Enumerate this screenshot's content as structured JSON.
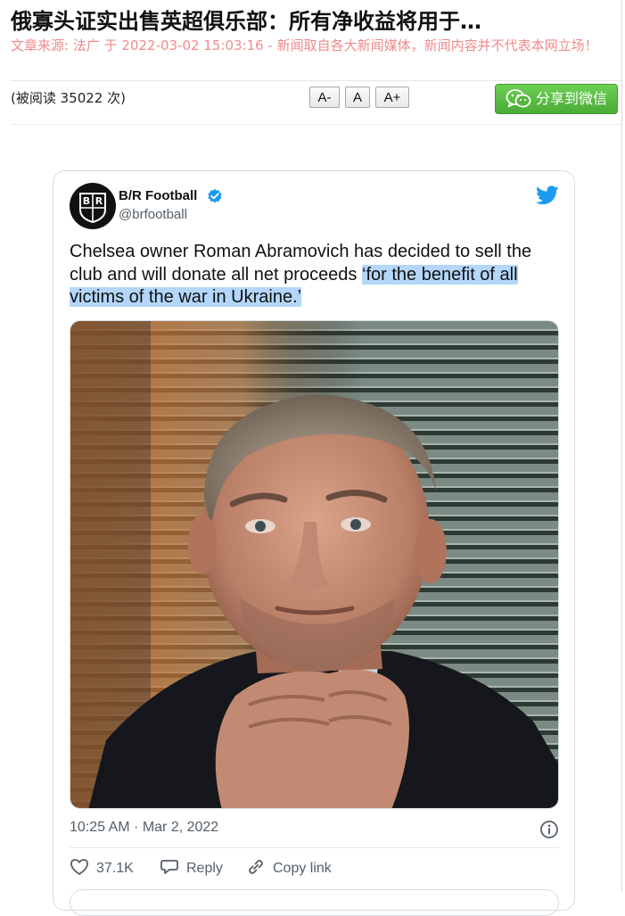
{
  "article": {
    "title": "俄寡头证实出售英超俱乐部：所有净收益将用于…",
    "meta": "文章来源: 法广 于 2022-03-02 15:03:16 - 新闻取自各大新闻媒体，新闻内容并不代表本网立场！",
    "read_count": "(被阅读 35022 次)"
  },
  "toolbar": {
    "font_decrease_label": "A-",
    "font_reset_label": "A",
    "font_increase_label": "A+",
    "share_label": "分享到微信",
    "share_icon": "wechat-icon",
    "share_color": "#55b53f"
  },
  "tweet": {
    "author_name": "B/R Football",
    "handle": "@brfootball",
    "avatar_text": "B R",
    "text_plain": "Chelsea owner Roman Abramovich has decided to sell the club and will donate all net proceeds ",
    "text_highlighted": "‘for the benefit of all victims of the war in Ukraine.’",
    "highlight_color": "#b3d6fa",
    "timestamp": "10:25 AM · Mar 2, 2022",
    "likes": "37.1K",
    "reply_label": "Reply",
    "copy_link_label": "Copy link",
    "icons": [
      "verified-badge-icon",
      "twitter-bird-icon",
      "info-icon",
      "heart-icon",
      "reply-bubble-icon",
      "link-icon"
    ],
    "accent_color": "#1d9bf0"
  }
}
